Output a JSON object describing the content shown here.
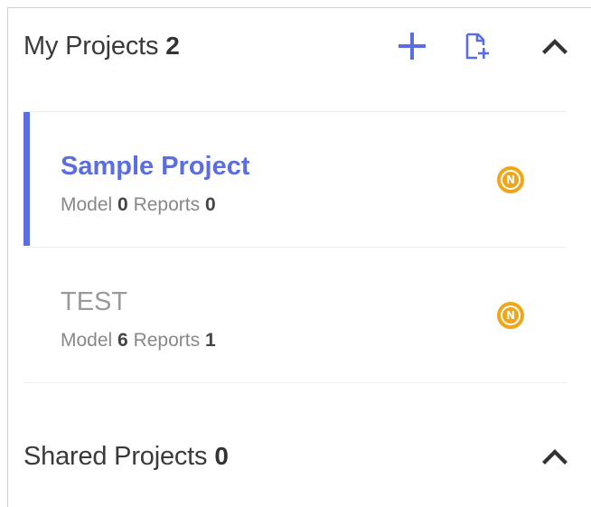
{
  "my_projects": {
    "title": "My Projects",
    "count": "2",
    "icons": {
      "add": "plus-icon",
      "new_file": "new-file-icon",
      "collapse": "chevron-up-icon"
    }
  },
  "projects": [
    {
      "name": "Sample Project",
      "model_label": "Model",
      "model_count": "0",
      "reports_label": "Reports",
      "reports_count": "0",
      "badge": "N",
      "active": true
    },
    {
      "name": "TEST",
      "model_label": "Model",
      "model_count": "6",
      "reports_label": "Reports",
      "reports_count": "1",
      "badge": "N",
      "active": false
    }
  ],
  "shared_projects": {
    "title": "Shared Projects",
    "count": "0",
    "icons": {
      "collapse": "chevron-up-icon"
    }
  },
  "colors": {
    "accent": "#5b6ee1",
    "badge": "#f2a516",
    "title_text": "#3a3a3a",
    "inactive_text": "#9a9a9a"
  }
}
